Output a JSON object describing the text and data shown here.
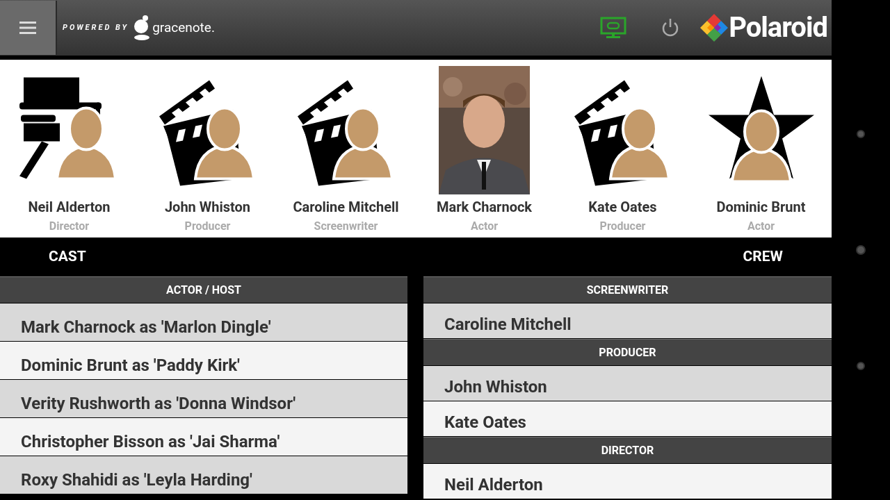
{
  "header": {
    "powered_by": "POWERED BY",
    "brand_text": "gracenote.",
    "logo_text": "Polaroid"
  },
  "credits": [
    {
      "name": "Neil Alderton",
      "role": "Director",
      "kind": "director"
    },
    {
      "name": "John Whiston",
      "role": "Producer",
      "kind": "clapper"
    },
    {
      "name": "Caroline Mitchell",
      "role": "Screenwriter",
      "kind": "clapper"
    },
    {
      "name": "Mark Charnock",
      "role": "Actor",
      "kind": "picture"
    },
    {
      "name": "Kate Oates",
      "role": "Producer",
      "kind": "clapper"
    },
    {
      "name": "Dominic Brunt",
      "role": "Actor",
      "kind": "star"
    }
  ],
  "tabs": [
    "CAST",
    "CREW"
  ],
  "cast": {
    "heading": "ACTOR / HOST",
    "rows": [
      "Mark Charnock as 'Marlon Dingle'",
      "Dominic Brunt as 'Paddy Kirk'",
      "Verity Rushworth as 'Donna Windsor'",
      "Christopher Bisson as 'Jai Sharma'",
      "Roxy Shahidi as 'Leyla Harding'"
    ]
  },
  "crew": [
    {
      "heading": "SCREENWRITER",
      "rows": [
        "Caroline Mitchell"
      ]
    },
    {
      "heading": "PRODUCER",
      "rows": [
        "John Whiston",
        "Kate Oates"
      ]
    },
    {
      "heading": "DIRECTOR",
      "rows": [
        "Neil Alderton"
      ]
    }
  ]
}
